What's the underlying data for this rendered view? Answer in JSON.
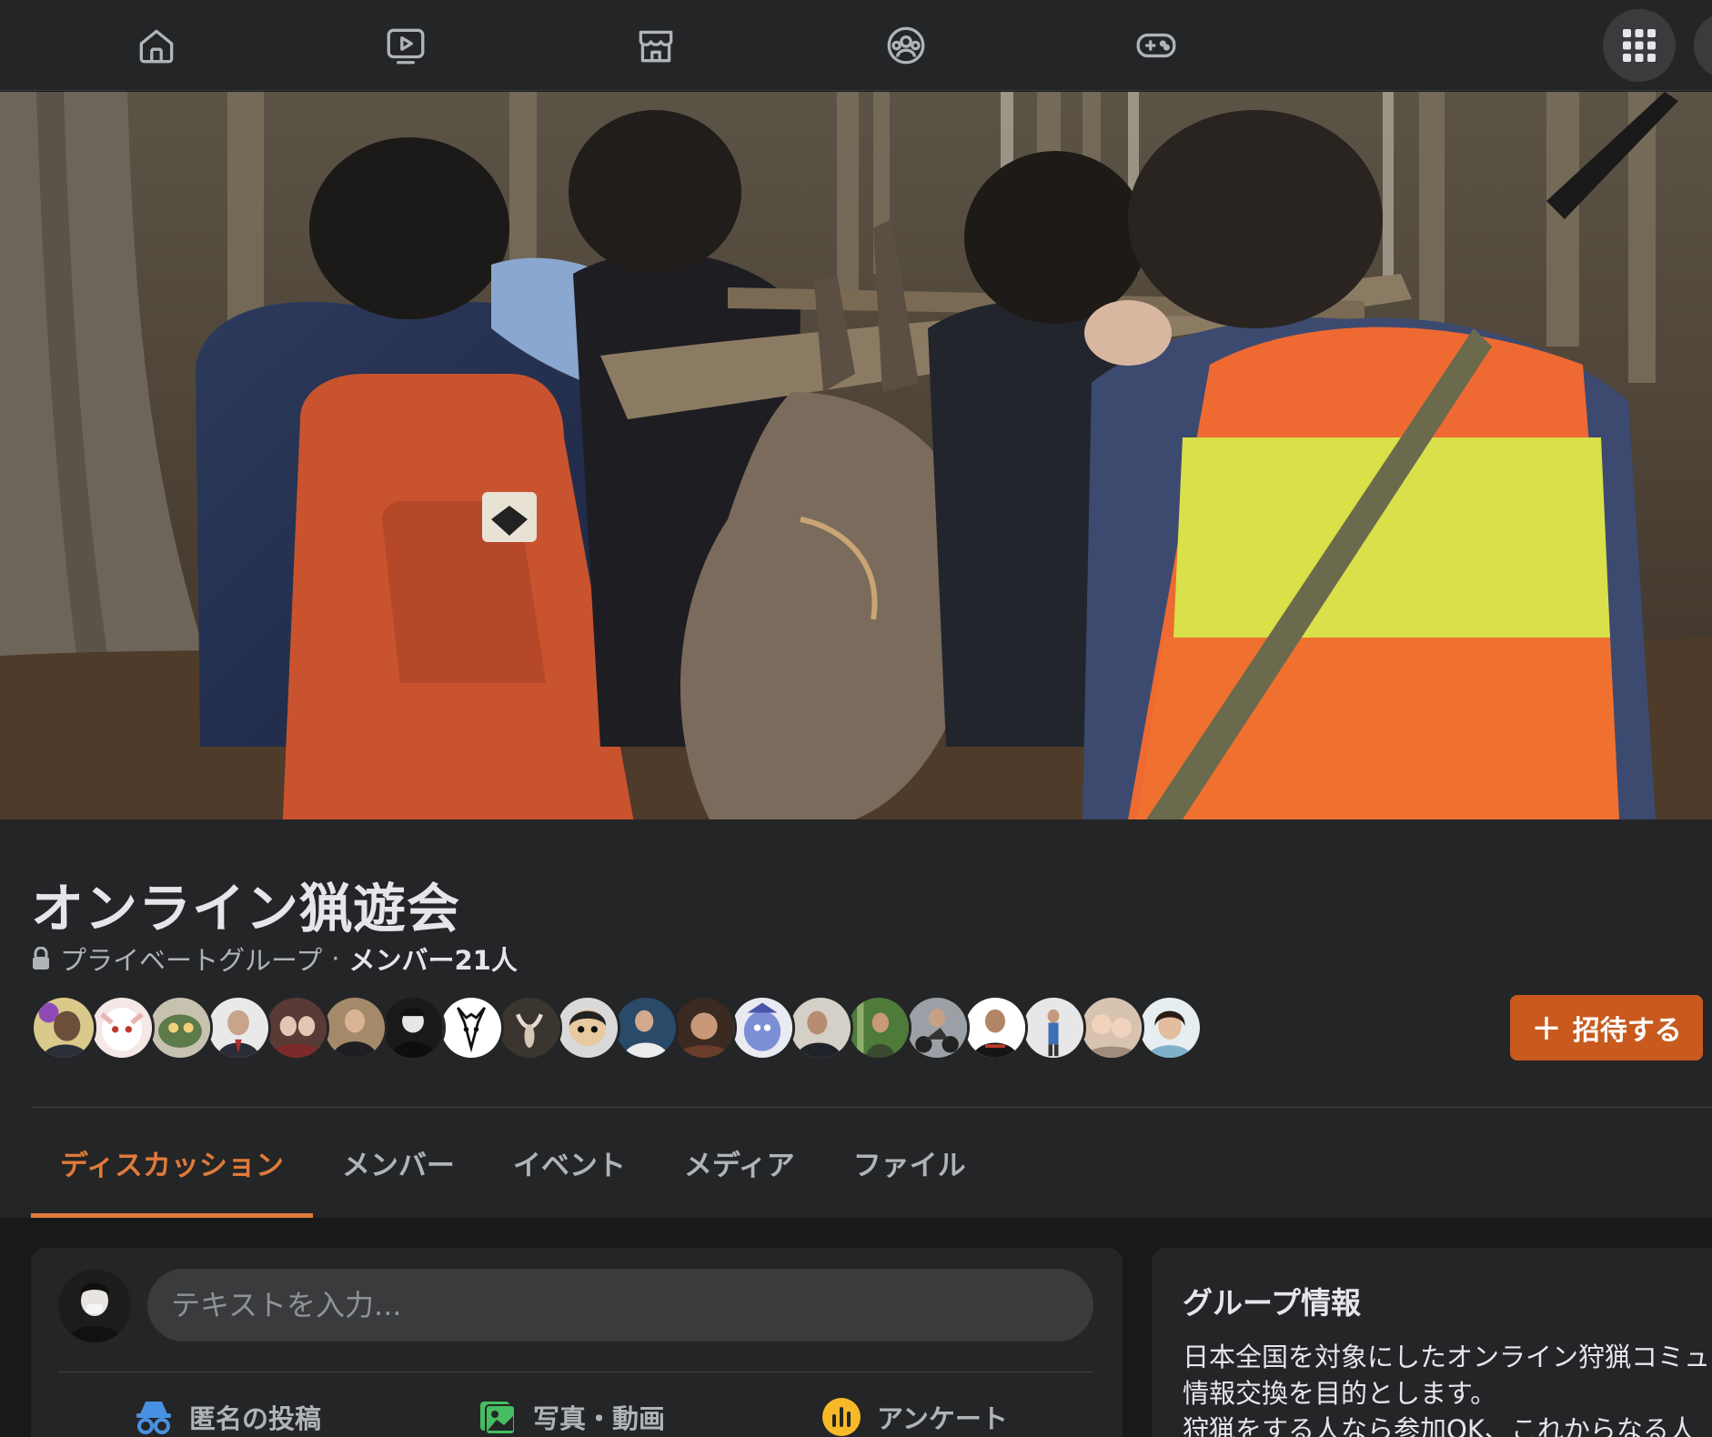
{
  "nav": {
    "icons": [
      "home-icon",
      "watch-icon",
      "marketplace-icon",
      "groups-icon",
      "gaming-icon"
    ],
    "apps_icon": "apps-grid-icon"
  },
  "group": {
    "name": "オンライン猟遊会",
    "privacy": "プライベートグループ",
    "separator": "·",
    "members": "メンバー21人",
    "invite_label": "招待する",
    "invite_icon": "+"
  },
  "tabs": [
    "ディスカッション",
    "メンバー",
    "イベント",
    "メディア",
    "ファイル"
  ],
  "active_tab": 0,
  "composer": {
    "placeholder": "テキストを入力...",
    "actions": {
      "anonymous": "匿名の投稿",
      "photo": "写真・動画",
      "poll": "アンケート"
    }
  },
  "info": {
    "title": "グループ情報",
    "description": "日本全国を対象にしたオンライン狩猟コミュ\n情報交換を目的とします。\n狩猟をする人なら参加OK、これからなる人"
  },
  "colors": {
    "accent": "#e07a3a",
    "invite_bg": "#c85a1e",
    "surface": "#242526",
    "background": "#18191a"
  }
}
